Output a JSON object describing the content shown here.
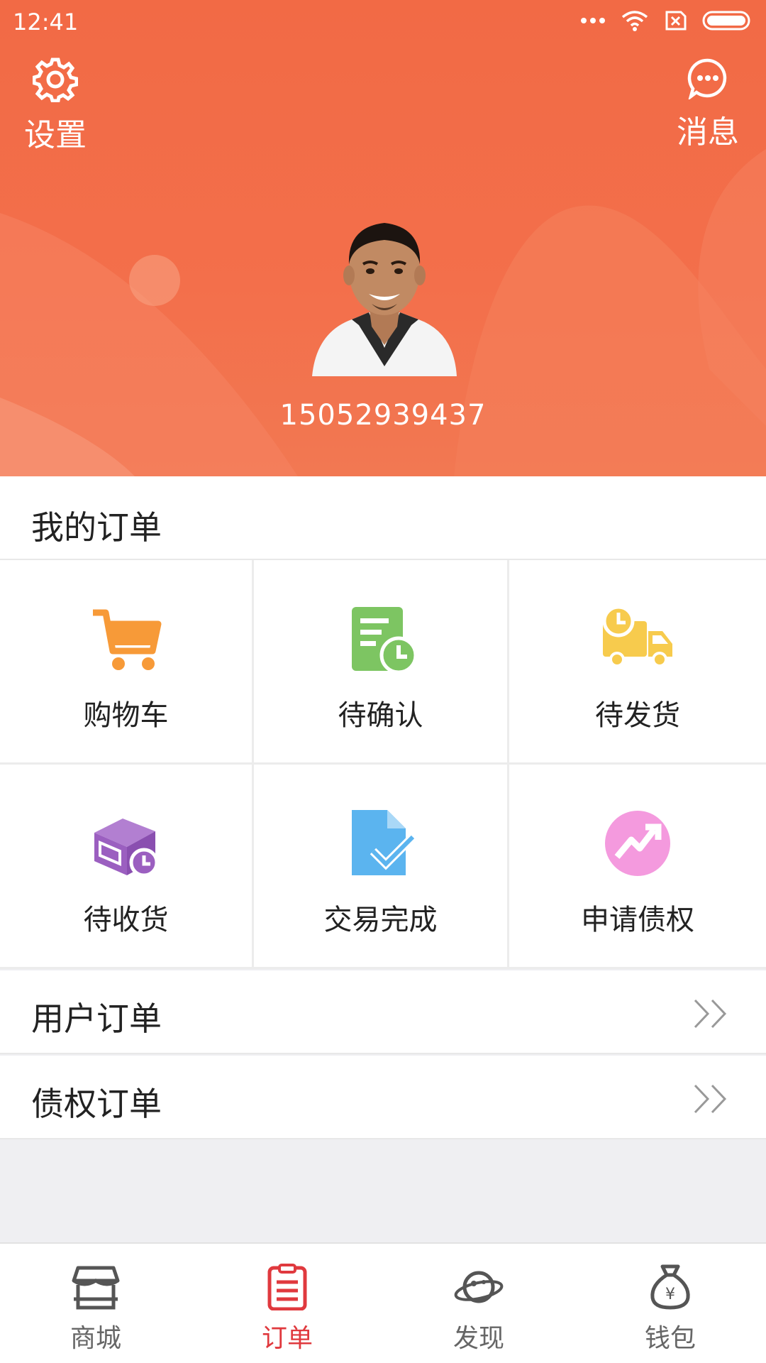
{
  "status_bar": {
    "time": "12:41"
  },
  "header": {
    "settings_label": "设置",
    "messages_label": "消息",
    "phone": "15052939437",
    "theme_color": "#f26a45"
  },
  "orders": {
    "title": "我的订单",
    "items": [
      {
        "label": "购物车",
        "icon": "shopping-cart-icon",
        "color": "#f79a38"
      },
      {
        "label": "待确认",
        "icon": "document-clock-icon",
        "color": "#7dc562"
      },
      {
        "label": "待发货",
        "icon": "delivery-truck-icon",
        "color": "#f7cb4d"
      },
      {
        "label": "待收货",
        "icon": "box-clock-icon",
        "color": "#9b5fc0"
      },
      {
        "label": "交易完成",
        "icon": "document-check-icon",
        "color": "#5bb4ef"
      },
      {
        "label": "申请债权",
        "icon": "trend-up-icon",
        "color": "#f49ade"
      }
    ]
  },
  "links": [
    {
      "label": "用户订单"
    },
    {
      "label": "债权订单"
    }
  ],
  "bottom_nav": {
    "items": [
      {
        "label": "商城",
        "icon": "store-icon",
        "active": false
      },
      {
        "label": "订单",
        "icon": "clipboard-list-icon",
        "active": true
      },
      {
        "label": "发现",
        "icon": "planet-icon",
        "active": false
      },
      {
        "label": "钱包",
        "icon": "money-bag-icon",
        "active": false
      }
    ],
    "active_color": "#e0393e"
  }
}
